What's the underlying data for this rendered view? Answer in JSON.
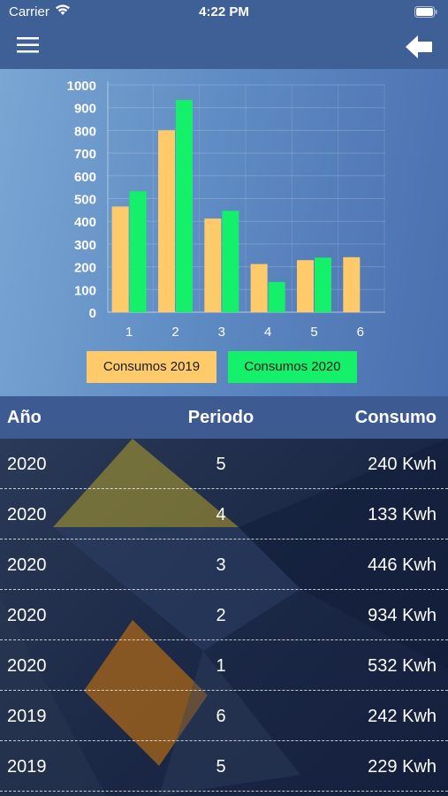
{
  "status_bar": {
    "carrier": "Carrier",
    "time": "4:22 PM"
  },
  "nav": {
    "menu_icon": "hamburger-menu-icon",
    "back_icon": "back-arrow-icon"
  },
  "chart_data": {
    "type": "bar",
    "categories": [
      "1",
      "2",
      "3",
      "4",
      "5",
      "6"
    ],
    "series": [
      {
        "name": "Consumos 2019",
        "color": "#ffca6a",
        "values": [
          465,
          800,
          412,
          212,
          229,
          242
        ]
      },
      {
        "name": "Consumos 2020",
        "color": "#14f06a",
        "values": [
          532,
          934,
          446,
          133,
          240,
          null
        ]
      }
    ],
    "yticks": [
      0,
      100,
      200,
      300,
      400,
      500,
      600,
      700,
      800,
      900,
      1000
    ],
    "ylim": [
      0,
      1000
    ],
    "grid": true,
    "legend_position": "bottom"
  },
  "table": {
    "headers": {
      "year": "Año",
      "period": "Periodo",
      "consumo": "Consumo"
    },
    "rows": [
      {
        "year": "2020",
        "period": "5",
        "consumo": "240 Kwh"
      },
      {
        "year": "2020",
        "period": "4",
        "consumo": "133 Kwh"
      },
      {
        "year": "2020",
        "period": "3",
        "consumo": "446 Kwh"
      },
      {
        "year": "2020",
        "period": "2",
        "consumo": "934 Kwh"
      },
      {
        "year": "2020",
        "period": "1",
        "consumo": "532 Kwh"
      },
      {
        "year": "2019",
        "period": "6",
        "consumo": "242 Kwh"
      },
      {
        "year": "2019",
        "period": "5",
        "consumo": "229 Kwh"
      }
    ]
  }
}
